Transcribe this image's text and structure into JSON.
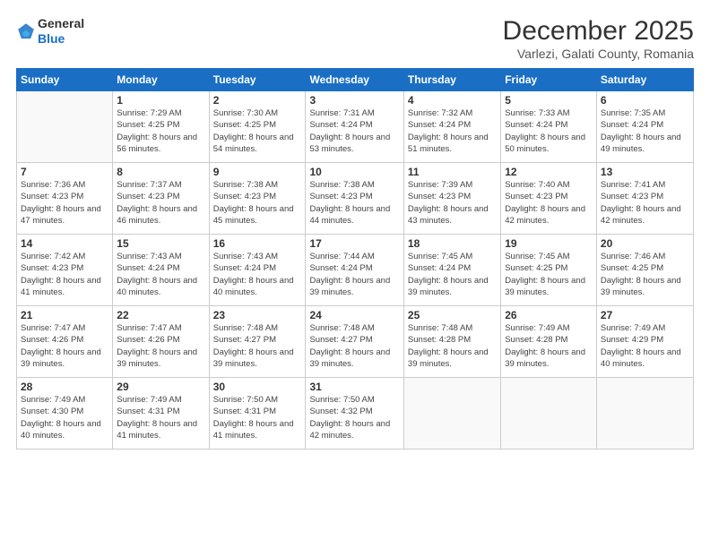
{
  "logo": {
    "general": "General",
    "blue": "Blue"
  },
  "title": "December 2025",
  "location": "Varlezi, Galati County, Romania",
  "weekdays": [
    "Sunday",
    "Monday",
    "Tuesday",
    "Wednesday",
    "Thursday",
    "Friday",
    "Saturday"
  ],
  "weeks": [
    [
      {
        "day": "",
        "sunrise": "",
        "sunset": "",
        "daylight": ""
      },
      {
        "day": "1",
        "sunrise": "Sunrise: 7:29 AM",
        "sunset": "Sunset: 4:25 PM",
        "daylight": "Daylight: 8 hours and 56 minutes."
      },
      {
        "day": "2",
        "sunrise": "Sunrise: 7:30 AM",
        "sunset": "Sunset: 4:25 PM",
        "daylight": "Daylight: 8 hours and 54 minutes."
      },
      {
        "day": "3",
        "sunrise": "Sunrise: 7:31 AM",
        "sunset": "Sunset: 4:24 PM",
        "daylight": "Daylight: 8 hours and 53 minutes."
      },
      {
        "day": "4",
        "sunrise": "Sunrise: 7:32 AM",
        "sunset": "Sunset: 4:24 PM",
        "daylight": "Daylight: 8 hours and 51 minutes."
      },
      {
        "day": "5",
        "sunrise": "Sunrise: 7:33 AM",
        "sunset": "Sunset: 4:24 PM",
        "daylight": "Daylight: 8 hours and 50 minutes."
      },
      {
        "day": "6",
        "sunrise": "Sunrise: 7:35 AM",
        "sunset": "Sunset: 4:24 PM",
        "daylight": "Daylight: 8 hours and 49 minutes."
      }
    ],
    [
      {
        "day": "7",
        "sunrise": "Sunrise: 7:36 AM",
        "sunset": "Sunset: 4:23 PM",
        "daylight": "Daylight: 8 hours and 47 minutes."
      },
      {
        "day": "8",
        "sunrise": "Sunrise: 7:37 AM",
        "sunset": "Sunset: 4:23 PM",
        "daylight": "Daylight: 8 hours and 46 minutes."
      },
      {
        "day": "9",
        "sunrise": "Sunrise: 7:38 AM",
        "sunset": "Sunset: 4:23 PM",
        "daylight": "Daylight: 8 hours and 45 minutes."
      },
      {
        "day": "10",
        "sunrise": "Sunrise: 7:38 AM",
        "sunset": "Sunset: 4:23 PM",
        "daylight": "Daylight: 8 hours and 44 minutes."
      },
      {
        "day": "11",
        "sunrise": "Sunrise: 7:39 AM",
        "sunset": "Sunset: 4:23 PM",
        "daylight": "Daylight: 8 hours and 43 minutes."
      },
      {
        "day": "12",
        "sunrise": "Sunrise: 7:40 AM",
        "sunset": "Sunset: 4:23 PM",
        "daylight": "Daylight: 8 hours and 42 minutes."
      },
      {
        "day": "13",
        "sunrise": "Sunrise: 7:41 AM",
        "sunset": "Sunset: 4:23 PM",
        "daylight": "Daylight: 8 hours and 42 minutes."
      }
    ],
    [
      {
        "day": "14",
        "sunrise": "Sunrise: 7:42 AM",
        "sunset": "Sunset: 4:23 PM",
        "daylight": "Daylight: 8 hours and 41 minutes."
      },
      {
        "day": "15",
        "sunrise": "Sunrise: 7:43 AM",
        "sunset": "Sunset: 4:24 PM",
        "daylight": "Daylight: 8 hours and 40 minutes."
      },
      {
        "day": "16",
        "sunrise": "Sunrise: 7:43 AM",
        "sunset": "Sunset: 4:24 PM",
        "daylight": "Daylight: 8 hours and 40 minutes."
      },
      {
        "day": "17",
        "sunrise": "Sunrise: 7:44 AM",
        "sunset": "Sunset: 4:24 PM",
        "daylight": "Daylight: 8 hours and 39 minutes."
      },
      {
        "day": "18",
        "sunrise": "Sunrise: 7:45 AM",
        "sunset": "Sunset: 4:24 PM",
        "daylight": "Daylight: 8 hours and 39 minutes."
      },
      {
        "day": "19",
        "sunrise": "Sunrise: 7:45 AM",
        "sunset": "Sunset: 4:25 PM",
        "daylight": "Daylight: 8 hours and 39 minutes."
      },
      {
        "day": "20",
        "sunrise": "Sunrise: 7:46 AM",
        "sunset": "Sunset: 4:25 PM",
        "daylight": "Daylight: 8 hours and 39 minutes."
      }
    ],
    [
      {
        "day": "21",
        "sunrise": "Sunrise: 7:47 AM",
        "sunset": "Sunset: 4:26 PM",
        "daylight": "Daylight: 8 hours and 39 minutes."
      },
      {
        "day": "22",
        "sunrise": "Sunrise: 7:47 AM",
        "sunset": "Sunset: 4:26 PM",
        "daylight": "Daylight: 8 hours and 39 minutes."
      },
      {
        "day": "23",
        "sunrise": "Sunrise: 7:48 AM",
        "sunset": "Sunset: 4:27 PM",
        "daylight": "Daylight: 8 hours and 39 minutes."
      },
      {
        "day": "24",
        "sunrise": "Sunrise: 7:48 AM",
        "sunset": "Sunset: 4:27 PM",
        "daylight": "Daylight: 8 hours and 39 minutes."
      },
      {
        "day": "25",
        "sunrise": "Sunrise: 7:48 AM",
        "sunset": "Sunset: 4:28 PM",
        "daylight": "Daylight: 8 hours and 39 minutes."
      },
      {
        "day": "26",
        "sunrise": "Sunrise: 7:49 AM",
        "sunset": "Sunset: 4:28 PM",
        "daylight": "Daylight: 8 hours and 39 minutes."
      },
      {
        "day": "27",
        "sunrise": "Sunrise: 7:49 AM",
        "sunset": "Sunset: 4:29 PM",
        "daylight": "Daylight: 8 hours and 40 minutes."
      }
    ],
    [
      {
        "day": "28",
        "sunrise": "Sunrise: 7:49 AM",
        "sunset": "Sunset: 4:30 PM",
        "daylight": "Daylight: 8 hours and 40 minutes."
      },
      {
        "day": "29",
        "sunrise": "Sunrise: 7:49 AM",
        "sunset": "Sunset: 4:31 PM",
        "daylight": "Daylight: 8 hours and 41 minutes."
      },
      {
        "day": "30",
        "sunrise": "Sunrise: 7:50 AM",
        "sunset": "Sunset: 4:31 PM",
        "daylight": "Daylight: 8 hours and 41 minutes."
      },
      {
        "day": "31",
        "sunrise": "Sunrise: 7:50 AM",
        "sunset": "Sunset: 4:32 PM",
        "daylight": "Daylight: 8 hours and 42 minutes."
      },
      {
        "day": "",
        "sunrise": "",
        "sunset": "",
        "daylight": ""
      },
      {
        "day": "",
        "sunrise": "",
        "sunset": "",
        "daylight": ""
      },
      {
        "day": "",
        "sunrise": "",
        "sunset": "",
        "daylight": ""
      }
    ]
  ]
}
